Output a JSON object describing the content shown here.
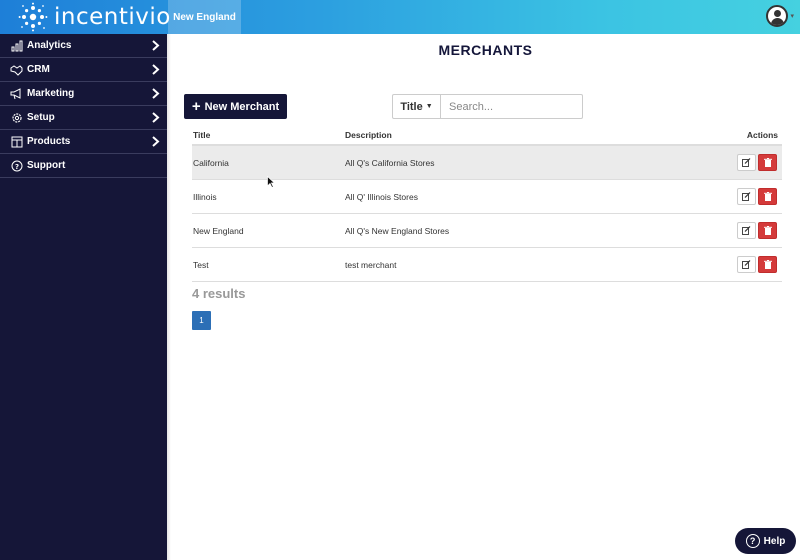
{
  "header": {
    "logo_text": "incentivio",
    "region_tab": "New England"
  },
  "sidebar": {
    "items": [
      {
        "label": "Analytics",
        "icon": "bar-chart-icon",
        "has_chevron": true
      },
      {
        "label": "CRM",
        "icon": "handshake-icon",
        "has_chevron": true
      },
      {
        "label": "Marketing",
        "icon": "megaphone-icon",
        "has_chevron": true
      },
      {
        "label": "Setup",
        "icon": "gear-icon",
        "has_chevron": true
      },
      {
        "label": "Products",
        "icon": "menu-board-icon",
        "has_chevron": true
      },
      {
        "label": "Support",
        "icon": "question-circle-icon",
        "has_chevron": false
      }
    ]
  },
  "main": {
    "page_title": "MERCHANTS",
    "new_button_label": "New Merchant",
    "filter": {
      "selected": "Title",
      "search_placeholder": "Search...",
      "search_value": ""
    },
    "table": {
      "columns": [
        "Title",
        "Description",
        "Actions"
      ],
      "rows": [
        {
          "title": "California",
          "description": "All Q's California Stores"
        },
        {
          "title": "Illinois",
          "description": "All Q' Illinois Stores"
        },
        {
          "title": "New England",
          "description": "All Q's New England Stores"
        },
        {
          "title": "Test",
          "description": "test merchant"
        }
      ]
    },
    "results_text": "4 results",
    "pagination": {
      "current_page": "1"
    }
  },
  "help": {
    "label": "Help"
  },
  "colors": {
    "sidebar_bg": "#151638",
    "header_gradient_start": "#1e7fd8",
    "header_gradient_end": "#45d1e0",
    "delete_red": "#d43a3a",
    "page_blue": "#2c6fb6"
  }
}
